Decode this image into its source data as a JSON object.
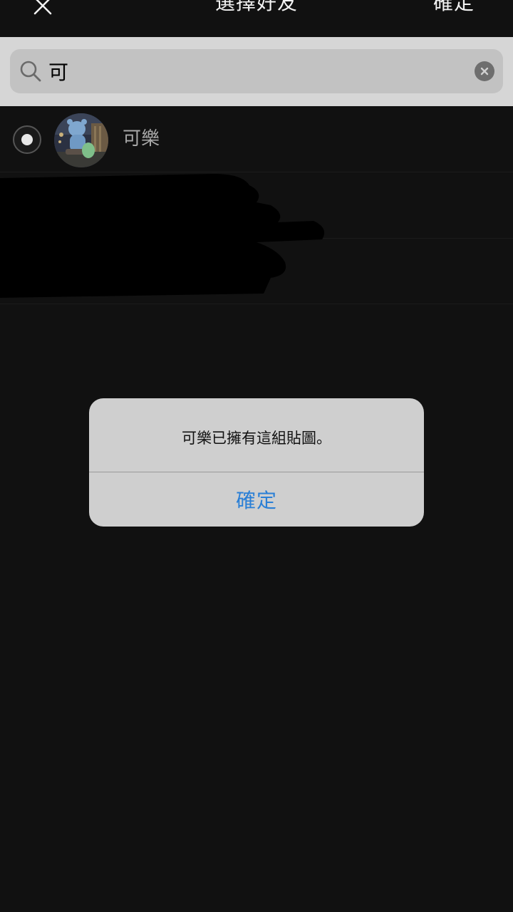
{
  "topbar": {
    "title": "選擇好友",
    "confirm_label": "確定",
    "close_icon": "close-icon"
  },
  "search": {
    "value": "可",
    "placeholder": "",
    "search_icon": "search-icon",
    "clear_icon": "clear-icon"
  },
  "friends": [
    {
      "name": "可樂",
      "selected": false
    }
  ],
  "alert": {
    "message": "可樂已擁有這組貼圖。",
    "button_label": "確定",
    "button_color": "#2a7fd6"
  },
  "colors": {
    "background": "#111111",
    "search_area": "#d6d6d6",
    "search_box": "#c2c2c2",
    "alert_bg": "#cfcfcf",
    "accent": "#2a7fd6"
  }
}
